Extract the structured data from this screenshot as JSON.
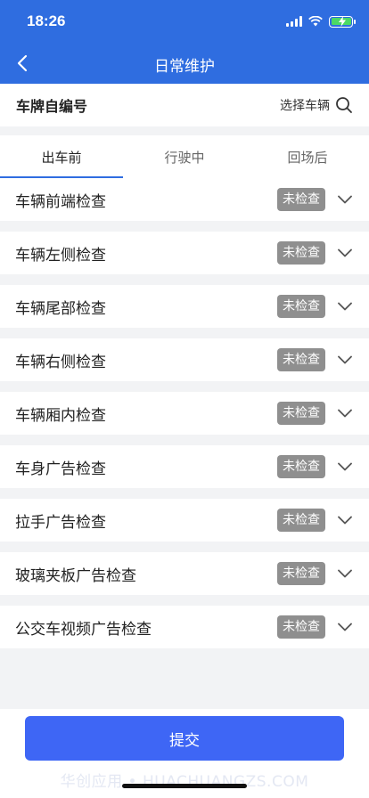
{
  "status_bar": {
    "time": "18:26"
  },
  "nav": {
    "title": "日常维护",
    "back_icon": "chevron-left-icon"
  },
  "plate": {
    "label": "车牌自编号",
    "select_label": "选择车辆",
    "search_icon": "search-icon"
  },
  "tabs": [
    {
      "label": "出车前",
      "active": true
    },
    {
      "label": "行驶中",
      "active": false
    },
    {
      "label": "回场后",
      "active": false
    }
  ],
  "items": [
    {
      "label": "车辆前端检查",
      "status": "未检查"
    },
    {
      "label": "车辆左侧检查",
      "status": "未检查"
    },
    {
      "label": "车辆尾部检查",
      "status": "未检查"
    },
    {
      "label": "车辆右侧检查",
      "status": "未检查"
    },
    {
      "label": "车辆厢内检查",
      "status": "未检查"
    },
    {
      "label": "车身广告检查",
      "status": "未检查"
    },
    {
      "label": "拉手广告检查",
      "status": "未检查"
    },
    {
      "label": "玻璃夹板广告检查",
      "status": "未检查"
    },
    {
      "label": "公交车视频广告检查",
      "status": "未检查"
    }
  ],
  "footer": {
    "submit_label": "提交",
    "watermark": "华创应用 • HUACHUANGZS.COM"
  },
  "colors": {
    "primary": "#2f6de0",
    "button": "#3e66f5",
    "badge": "#8f8f8f"
  }
}
